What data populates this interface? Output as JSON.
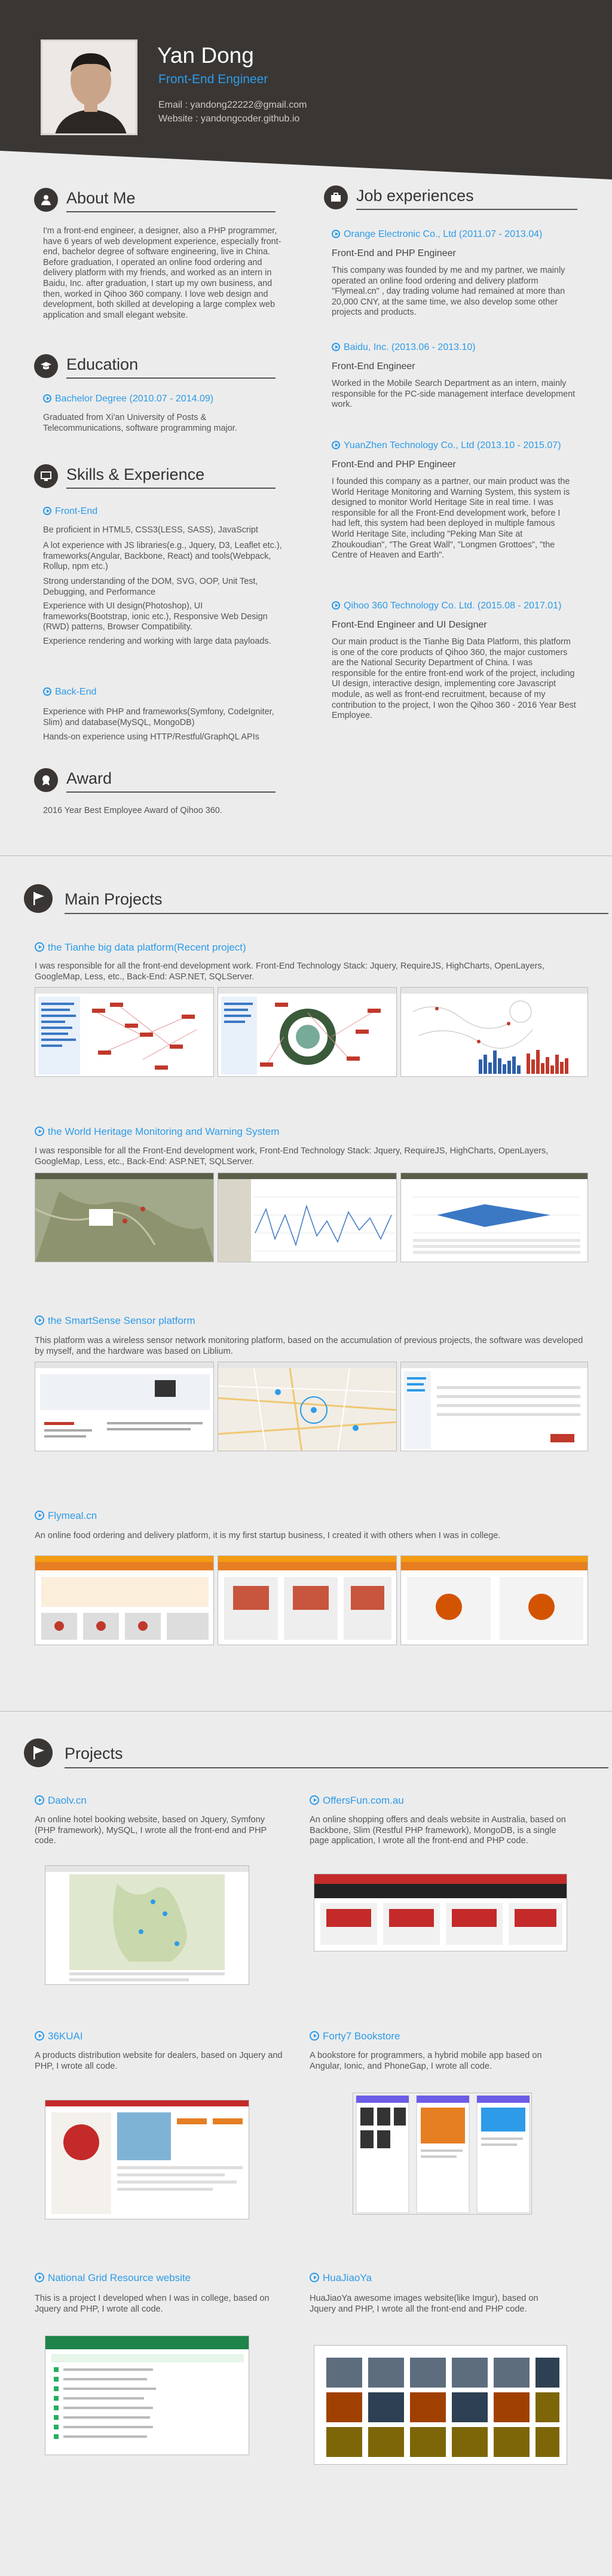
{
  "header": {
    "name": "Yan Dong",
    "role": "Front-End Engineer",
    "email": "Email : yandong22222@gmail.com",
    "website": "Website : yandongcoder.github.io"
  },
  "about": {
    "title": "About Me",
    "text": "I'm a front-end engineer, a designer, also a PHP programmer, have 6 years of web development experience, especially front-end,  bachelor degree of software engineering, live in China.\nBefore graduation, I operated an online food ordering and delivery platform with my friends, and worked as an intern in Baidu, Inc. after graduation, I start up my own business, and then, worked in Qihoo 360 company. I love web design and development, both skilled at developing a large complex web application and small elegant website."
  },
  "education": {
    "title": "Education",
    "school": "Bachelor Degree  (2010.07 - 2014.09)",
    "text": "Graduated from Xi'an University of Posts & Telecommunications, software programming major."
  },
  "skills": {
    "title": "Skills & Experience",
    "frontend_title": "Front-End",
    "frontend_items": [
      "Be proficient in HTML5, CSS3(LESS, SASS), JavaScript",
      "A lot experience with JS libraries(e.g., Jquery, D3, Leaflet etc.), frameworks(Angular, Backbone, React) and tools(Webpack, Rollup, npm etc.)",
      "Strong understanding of the DOM, SVG, OOP, Unit Test, Debugging, and Performance",
      "Experience with UI design(Photoshop), UI frameworks(Bootstrap, ionic etc.), Responsive Web Design (RWD) patterns, Browser Compatibility.",
      "Experience rendering and working with large data payloads."
    ],
    "backend_title": "Back-End",
    "backend_items": [
      "Experience with PHP and frameworks(Symfony, CodeIgniter, Slim) and database(MySQL, MongoDB)",
      "Hands-on experience using HTTP/Restful/GraphQL APIs"
    ]
  },
  "award": {
    "title": "Award",
    "text": "2016 Year Best Employee Award of Qihoo 360."
  },
  "jobs": {
    "title": "Job experiences",
    "items": [
      {
        "company": "Orange Electronic Co., Ltd  (2011.07 - 2013.04)",
        "position": "Front-End and PHP Engineer",
        "text": "This company was founded by me and my partner,  we mainly operated an online food ordering and delivery platform  \"Flymeal.cn\" , day trading volume had remained at more than 20,000 CNY, at the same time, we also develop some other projects and products."
      },
      {
        "company": "Baidu, Inc.  (2013.06 - 2013.10)",
        "position": "Front-End Engineer",
        "text": "Worked in the Mobile Search Department as an intern, mainly responsible for the PC-side management interface development work."
      },
      {
        "company": "YuanZhen Technology Co., Ltd  (2013.10 - 2015.07)",
        "position": "Front-End and PHP Engineer",
        "text": "I founded this company as a partner,  our main product was the World Heritage Monitoring and Warning System, this system is designed to monitor World Heritage Site in real time. I was responsible for all the Front-End development work, before I had left, this system had been deployed in multiple famous World Heritage Site, including \"Peking Man Site at Zhoukoudian\", \"The Great Wall\", \"Longmen Grottoes\", \"the Centre of Heaven and Earth\"."
      },
      {
        "company": "Qihoo 360 Technology Co. Ltd.  (2015.08 - 2017.01)",
        "position": "Front-End Engineer and UI Designer",
        "text": "Our main product is the Tianhe Big Data Platform, this platform is one of the core products of Qihoo 360, the major customers are the National Security Department of China. I was responsible for the entire front-end work of the project, including UI design, interactive design, implementing core Javascript module, as well as front-end recruitment, because of my contribution to the project, I won the Qihoo 360 - 2016 Year Best Employee."
      }
    ]
  },
  "main_projects": {
    "title": "Main Projects",
    "items": [
      {
        "title": "the Tianhe big data platform(Recent project)",
        "text": "I was responsible for all the front-end development work. Front-End Technology Stack: Jquery, RequireJS, HighCharts, OpenLayers, GoogleMap, Less, etc., Back-End: ASP.NET, SQLServer."
      },
      {
        "title": "the World Heritage Monitoring and Warning System",
        "text": "I was responsible for all the Front-End development work, Front-End Technology Stack: Jquery, RequireJS, HighCharts, OpenLayers, GoogleMap, Less, etc., Back-End: ASP.NET, SQLServer."
      },
      {
        "title": "the SmartSense Sensor platform",
        "text": "This platform was a wireless sensor network monitoring platform, based on the accumulation of previous projects, the software was developed by myself, and the hardware was based on Liblium."
      },
      {
        "title": "Flymeal.cn",
        "text": "An online food ordering and delivery platform, it is my first startup business, I created it with others when I was in college."
      }
    ]
  },
  "projects": {
    "title": "Projects",
    "items": [
      {
        "title": "Daolv.cn",
        "text": "An online hotel booking website, based on Jquery, Symfony (PHP framework), MySQL, I wrote all the front-end and PHP code."
      },
      {
        "title": "OffersFun.com.au",
        "text": "An online shopping offers and deals website in Australia, based on Backbone, Slim (Restful PHP framework), MongoDB, is a single page application, I wrote all the front-end and PHP code."
      },
      {
        "title": "36KUAI",
        "text": "A products distribution website for dealers, based on Jquery and PHP, I wrote all code."
      },
      {
        "title": "Forty7 Bookstore",
        "text": "A bookstore for programmers, a hybrid mobile app based on Angular, Ionic, and PhoneGap, I wrote all code."
      },
      {
        "title": "National Grid Resource website",
        "text": "This is a project I developed when I was in college, based on Jquery and PHP, I wrote all code."
      },
      {
        "title": "HuaJiaoYa",
        "text": "HuaJiaoYa awesome images website(like Imgur), based on Jquery and PHP, I wrote all the front-end and PHP code."
      }
    ]
  },
  "colors": {
    "accent": "#2d9be8",
    "header_bg": "#3a3634"
  }
}
